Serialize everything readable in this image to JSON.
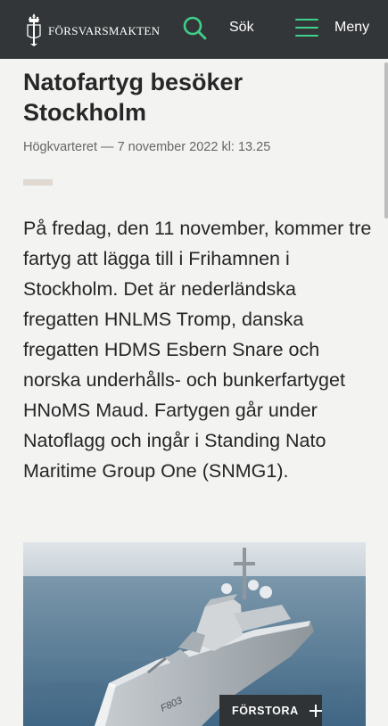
{
  "header": {
    "brand": "FÖRSVARSMAKTEN",
    "search_label": "Sök",
    "menu_label": "Meny",
    "accent_color": "#3fd18c",
    "background_color": "#333638"
  },
  "article": {
    "title": "Natofartyg besöker Stockholm",
    "meta": "Högkvarteret — 7 november 2022 kl: 13.25",
    "lead": "På fredag, den 11 november, kommer tre fartyg att lägga till i Frihamnen i Stockholm. Det är nederländska fregatten HNLMS Tromp, danska fregatten HDMS Esbern Snare och norska underhålls- och bunkerfartyget HNoMS Maud. Fartygen går under Natoflagg och ingår i Standing Nato Maritime Group One (SNMG1).",
    "image": {
      "hull_number": "F803",
      "enlarge_label": "FÖRSTORA",
      "enlarge_icon": "plus-icon"
    }
  }
}
